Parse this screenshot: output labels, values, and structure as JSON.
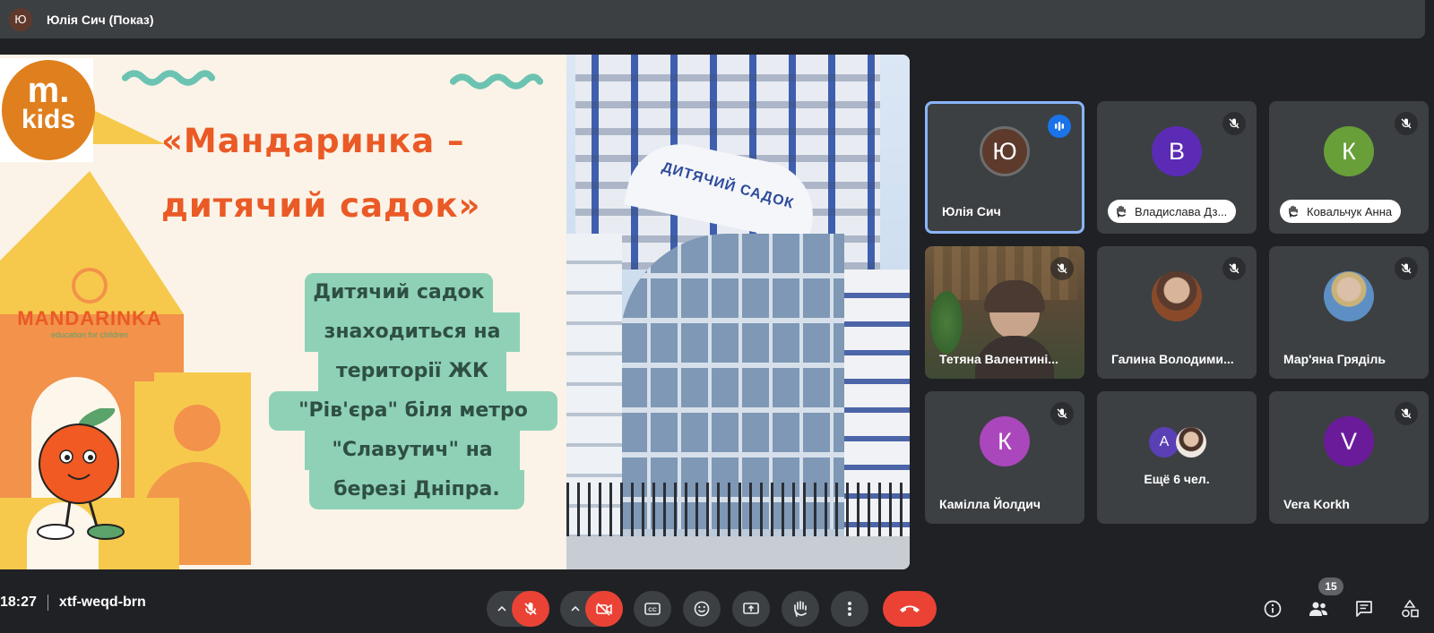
{
  "presenter": {
    "initial": "Ю",
    "label": "Юлія Сич (Показ)"
  },
  "slide": {
    "logo_top": "m.",
    "logo_bottom": "kids",
    "title_line1": "«Мандаринка –",
    "title_line2": "дитячий садок»",
    "body_lines": [
      "Дитячий садок",
      "знаходиться на",
      "території ЖК",
      "\"Рів'єра\" біля метро",
      "\"Славутич\" на",
      "березі Дніпра."
    ],
    "brand": "MANDARINKA",
    "brand_sub": "education for children",
    "building_sign": "ДИТЯЧИЙ САДОК"
  },
  "participants": [
    {
      "initial": "Ю",
      "name": "Юлія Сич",
      "color": "#5d3a2c",
      "speaking": true
    },
    {
      "initial": "В",
      "name": "Владислава Дз...",
      "color": "#5b2bb5",
      "hand": true
    },
    {
      "initial": "К",
      "name": "Ковальчук Анна",
      "color": "#689f38",
      "hand": true
    },
    {
      "name": "Тетяна Валентині...",
      "video": true
    },
    {
      "name": "Галина Володими...",
      "photo": true
    },
    {
      "name": "Мар'яна Гряділь",
      "photo": true
    },
    {
      "initial": "К",
      "name": "Камілла Йолдич",
      "color": "#ab47bc"
    },
    {
      "initial": "А",
      "name": "Ещё 6 чел.",
      "color": "#5b3fb5"
    },
    {
      "initial": "V",
      "name": "Vera Korkh",
      "color": "#6a1b9a"
    }
  ],
  "bottom": {
    "time": "18:27",
    "meeting_code": "xtf-weqd-brn",
    "people_count": "15"
  },
  "colors": {
    "background": "#202124",
    "tile": "#3c4043",
    "danger": "#ea4335",
    "active_border": "#8ab4f8"
  }
}
